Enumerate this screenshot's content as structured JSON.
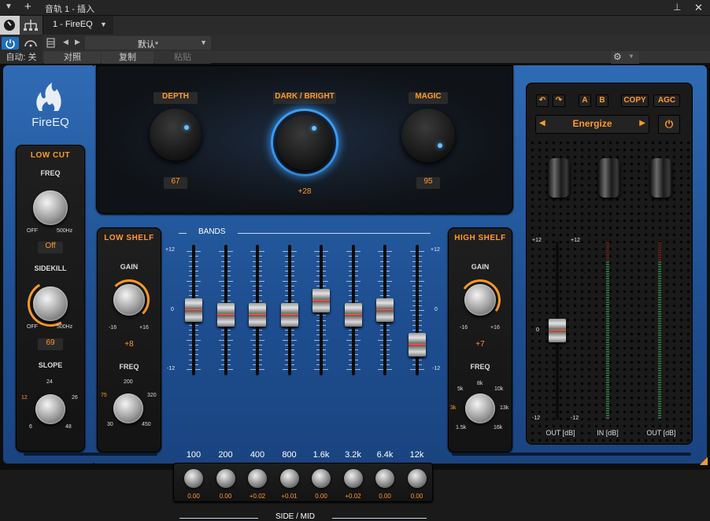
{
  "titlebar": {
    "title": "音轨 1 - 插入",
    "add_label": "+",
    "pin_label": "⊥",
    "close_label": "✕",
    "menu_arrow": "▼"
  },
  "toolbar": {
    "instance": "1 - FireEQ",
    "instance_arrow": "▼",
    "preset": "默认*",
    "preset_arrow": "▼",
    "auto_label": "自动: 关",
    "compare_label": "对照",
    "copy_label": "复制",
    "paste_label": "粘贴",
    "gear_arrow": "▼"
  },
  "plugin": {
    "brand": "FireEQ",
    "top": {
      "depth_label": "DEPTH",
      "depth_value": "67",
      "darkbright_label": "DARK / BRIGHT",
      "darkbright_value": "+28",
      "magic_label": "MAGIC",
      "magic_value": "95"
    },
    "lowcut": {
      "title": "LOW CUT",
      "freq_label": "FREQ",
      "freq_min": "OFF",
      "freq_max": "500Hz",
      "freq_value": "Off",
      "sidekill_label": "SIDEKILL",
      "sidekill_min": "OFF",
      "sidekill_max": "500Hz",
      "sidekill_value": "69",
      "slope_label": "SLOPE",
      "slope_ticks": [
        "12",
        "24",
        "26",
        "6",
        "48"
      ]
    },
    "lowshelf": {
      "title": "LOW SHELF",
      "gain_label": "GAIN",
      "gain_min": "-16",
      "gain_max": "+16",
      "gain_value": "+8",
      "freq_label": "FREQ",
      "freq_ticks": [
        "75",
        "200",
        "320",
        "30",
        "450"
      ]
    },
    "highshelf": {
      "title": "HIGH SHELF",
      "gain_label": "GAIN",
      "gain_min": "-16",
      "gain_max": "+16",
      "gain_value": "+7",
      "freq_label": "FREQ",
      "freq_ticks": [
        "5k",
        "8k",
        "10k",
        "3k",
        "13k",
        "1.5k",
        "16k"
      ]
    },
    "bands": {
      "title": "BANDS",
      "scale": [
        "+12",
        "0",
        "-12"
      ],
      "labels": [
        "100",
        "200",
        "400",
        "800",
        "1.6k",
        "3.2k",
        "6.4k",
        "12k"
      ],
      "gains_db": [
        0,
        -1,
        -1,
        -1,
        2,
        -1,
        0,
        -7
      ],
      "side_mid_label": "SIDE / MID",
      "side_mid_values": [
        "0.00",
        "0.00",
        "+0.02",
        "+0.01",
        "0.00",
        "+0.02",
        "0.00",
        "0.00"
      ]
    },
    "right": {
      "undo_label": "↶",
      "redo_label": "↷",
      "a_label": "A",
      "b_label": "B",
      "copy_label": "COPY",
      "agc_label": "AGC",
      "preset_name": "Energize",
      "prev_label": "◀",
      "next_label": "▶",
      "power_label": "⏻",
      "out_scale": [
        "+12",
        "0",
        "-12"
      ],
      "in_scale": [
        "+12",
        "-12"
      ],
      "out_label": "OUT [dB]",
      "in_label": "IN [dB]",
      "out2_label": "OUT [dB]",
      "out_gain_db": 0
    }
  },
  "colors": {
    "accent": "#ff9a2a",
    "blue": "#2a66b0",
    "led": "#5ab8ff"
  }
}
